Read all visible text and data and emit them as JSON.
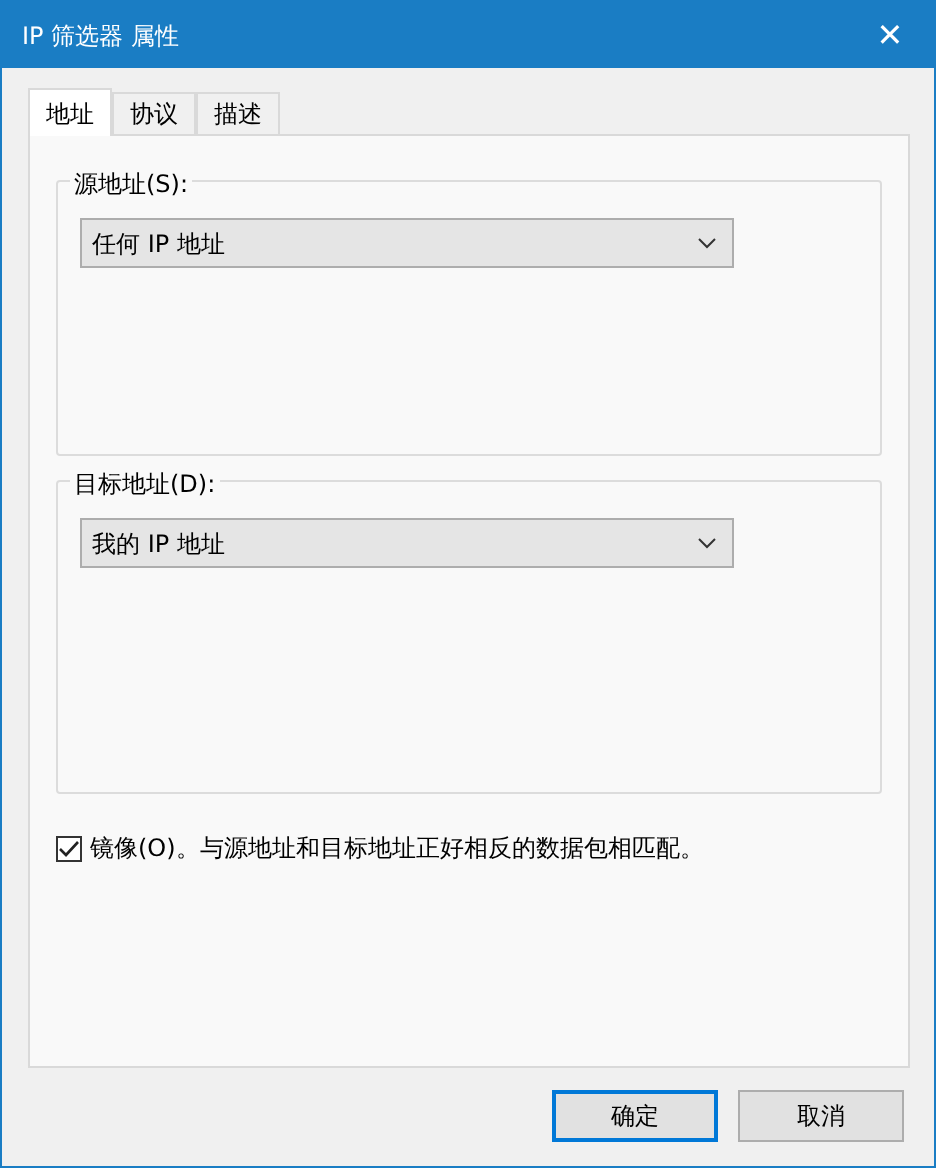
{
  "window": {
    "title": "IP 筛选器 属性",
    "close": "✕"
  },
  "tabs": [
    {
      "label": "地址",
      "selected": true
    },
    {
      "label": "协议",
      "selected": false
    },
    {
      "label": "描述",
      "selected": false
    }
  ],
  "groups": [
    {
      "label": "源地址(S):",
      "value": "任何 IP 地址"
    },
    {
      "label": "目标地址(D):",
      "value": "我的 IP 地址"
    }
  ],
  "mirror": {
    "label": "镜像(O)。与源地址和目标地址正好相反的数据包相匹配。",
    "checked": true
  },
  "buttons": [
    {
      "label": "确定",
      "default": true
    },
    {
      "label": "取消",
      "default": false
    }
  ]
}
